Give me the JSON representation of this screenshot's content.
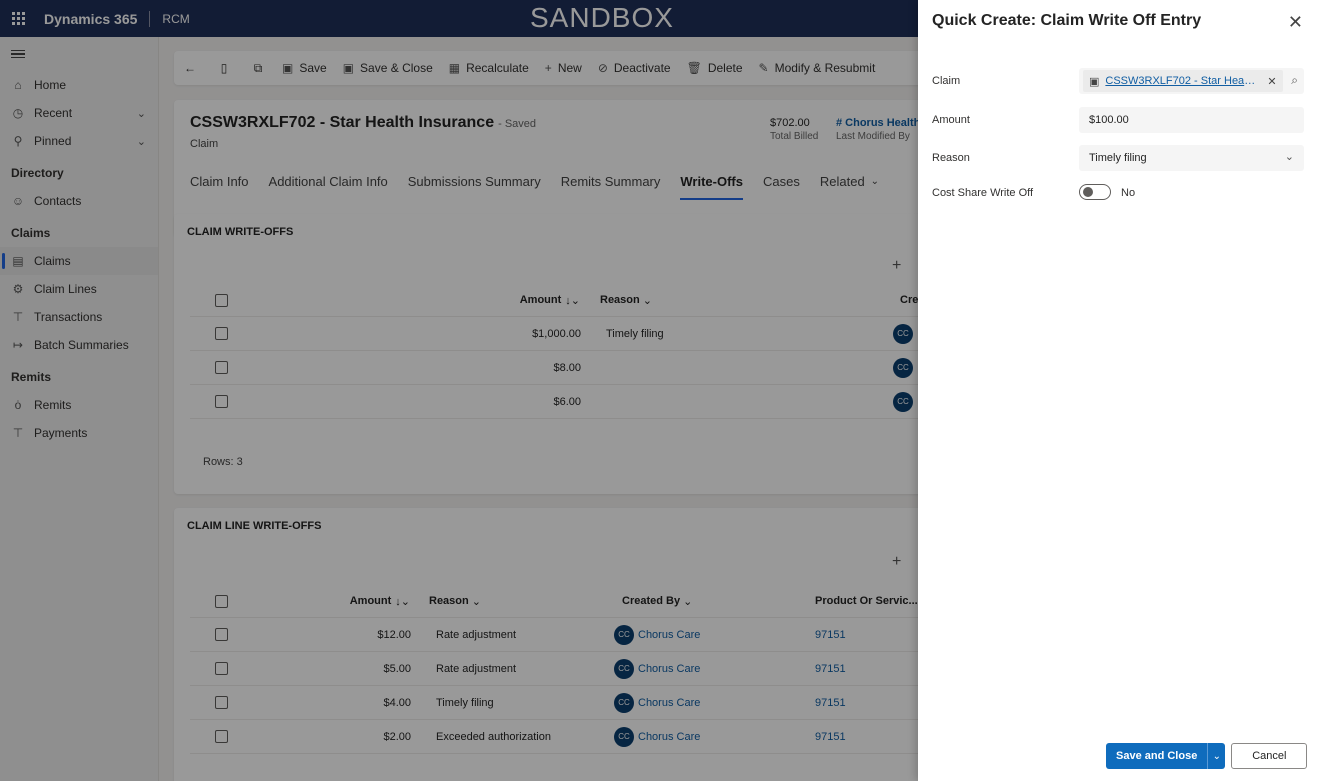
{
  "topbar": {
    "app_name": "Dynamics 365",
    "env_name": "RCM",
    "sandbox": "SANDBOX"
  },
  "sidebar": {
    "items": [
      {
        "label": "Home",
        "icon": "home-icon"
      },
      {
        "label": "Recent",
        "icon": "clock-icon"
      },
      {
        "label": "Pinned",
        "icon": "pin-icon"
      }
    ],
    "groups": [
      {
        "title": "Directory",
        "items": [
          {
            "label": "Contacts",
            "icon": "person-icon"
          }
        ]
      },
      {
        "title": "Claims",
        "items": [
          {
            "label": "Claims",
            "icon": "claim-icon"
          },
          {
            "label": "Claim Lines",
            "icon": "claim-lines-icon"
          },
          {
            "label": "Transactions",
            "icon": "transactions-icon"
          },
          {
            "label": "Batch Summaries",
            "icon": "batch-icon"
          }
        ]
      },
      {
        "title": "Remits",
        "items": [
          {
            "label": "Remits",
            "icon": "money-bag-icon"
          },
          {
            "label": "Payments",
            "icon": "payments-icon"
          }
        ]
      }
    ]
  },
  "commandbar": {
    "save": "Save",
    "save_close": "Save & Close",
    "recalculate": "Recalculate",
    "new": "New",
    "deactivate": "Deactivate",
    "delete": "Delete",
    "modify_resubmit": "Modify & Resubmit"
  },
  "record": {
    "title": "CSSW3RXLF702 - Star Health Insurance",
    "saved": "- Saved",
    "entity": "Claim",
    "total_billed_value": "$702.00",
    "total_billed_label": "Total Billed",
    "modified_by_value": "# Chorus Health",
    "modified_by_label": "Last Modified By"
  },
  "tabs": [
    "Claim Info",
    "Additional Claim Info",
    "Submissions Summary",
    "Remits Summary",
    "Write-Offs",
    "Cases",
    "Related"
  ],
  "claim_writeoffs": {
    "title": "CLAIM WRITE-OFFS",
    "headers": {
      "amount": "Amount",
      "reason": "Reason",
      "created": "Cre"
    },
    "rows": [
      {
        "amount": "$1,000.00",
        "reason": "Timely filing",
        "initials": "CC"
      },
      {
        "amount": "$8.00",
        "reason": "",
        "initials": "CC"
      },
      {
        "amount": "$6.00",
        "reason": "",
        "initials": "CC"
      }
    ],
    "rows_count": "Rows: 3"
  },
  "claim_line_writeoffs": {
    "title": "CLAIM LINE WRITE-OFFS",
    "headers": {
      "amount": "Amount",
      "reason": "Reason",
      "created_by": "Created By",
      "product": "Product Or Servic..."
    },
    "rows": [
      {
        "amount": "$12.00",
        "reason": "Rate adjustment",
        "initials": "CC",
        "created_by": "Chorus Care",
        "product": "97151"
      },
      {
        "amount": "$5.00",
        "reason": "Rate adjustment",
        "initials": "CC",
        "created_by": "Chorus Care",
        "product": "97151"
      },
      {
        "amount": "$4.00",
        "reason": "Timely filing",
        "initials": "CC",
        "created_by": "Chorus Care",
        "product": "97151"
      },
      {
        "amount": "$2.00",
        "reason": "Exceeded authorization",
        "initials": "CC",
        "created_by": "Chorus Care",
        "product": "97151"
      }
    ]
  },
  "quick_create": {
    "title": "Quick Create: Claim Write Off Entry",
    "claim_label": "Claim",
    "claim_value": "CSSW3RXLF702 - Star Health...",
    "amount_label": "Amount",
    "amount_value": "$100.00",
    "reason_label": "Reason",
    "reason_value": "Timely filing",
    "cost_share_label": "Cost Share Write Off",
    "cost_share_value": "No",
    "save_close": "Save and Close",
    "cancel": "Cancel"
  },
  "colors": {
    "topbar": "#1f2f59",
    "accent": "#0f6cbd",
    "link": "#115ea3"
  }
}
